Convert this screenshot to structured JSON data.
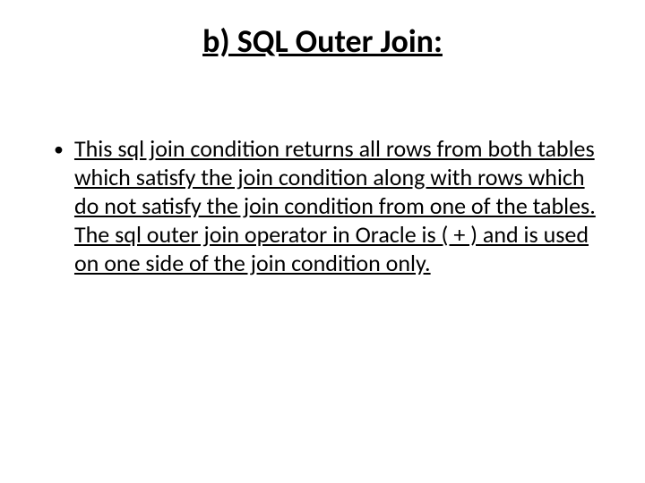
{
  "slide": {
    "title": "b) SQL Outer Join:",
    "bullets": [
      {
        "text": "This sql join condition returns all rows from both tables which satisfy the join condition along with rows which do not satisfy the join condition from one of the tables. The sql outer join operator in Oracle is ( + ) and is used on one side of the join condition only."
      }
    ]
  }
}
